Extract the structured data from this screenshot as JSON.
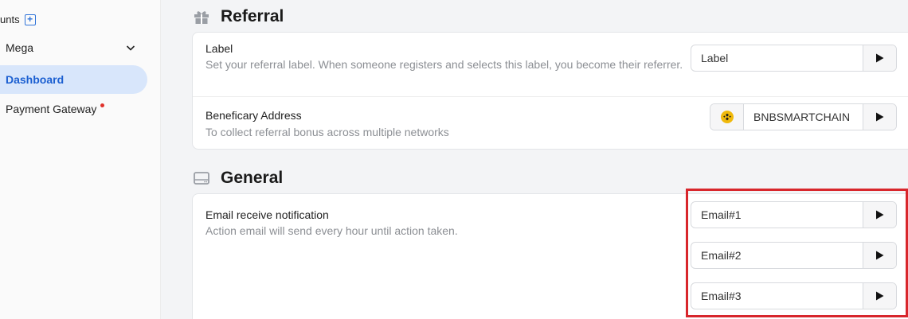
{
  "sidebar": {
    "header_label": "unts",
    "items": [
      {
        "label": "Mega"
      },
      {
        "label": "Dashboard"
      },
      {
        "label": "Payment Gateway"
      }
    ]
  },
  "referral": {
    "title": "Referral",
    "label_row": {
      "title": "Label",
      "desc": "Set your referral label. When someone registers and selects this label, you become their referrer.",
      "value": "Label"
    },
    "beneficiary_row": {
      "title": "Beneficary Address",
      "desc": "To collect referral bonus across multiple networks",
      "network": "BNBSMARTCHAIN"
    }
  },
  "general": {
    "title": "General",
    "email_row": {
      "title": "Email receive notification",
      "desc": "Action email will send every hour until action taken.",
      "emails": [
        "Email#1",
        "Email#2",
        "Email#3"
      ]
    }
  },
  "colors": {
    "accent": "#1b5fd1",
    "active_bg": "#d8e6fb",
    "highlight": "#d8262c",
    "bnb": "#f0b90b"
  },
  "icons": {
    "gift": "gift-icon",
    "drive": "hard-drive-icon",
    "play": "play-icon",
    "chevron": "chevron-down-icon",
    "bnb": "bnb-coin-icon"
  }
}
